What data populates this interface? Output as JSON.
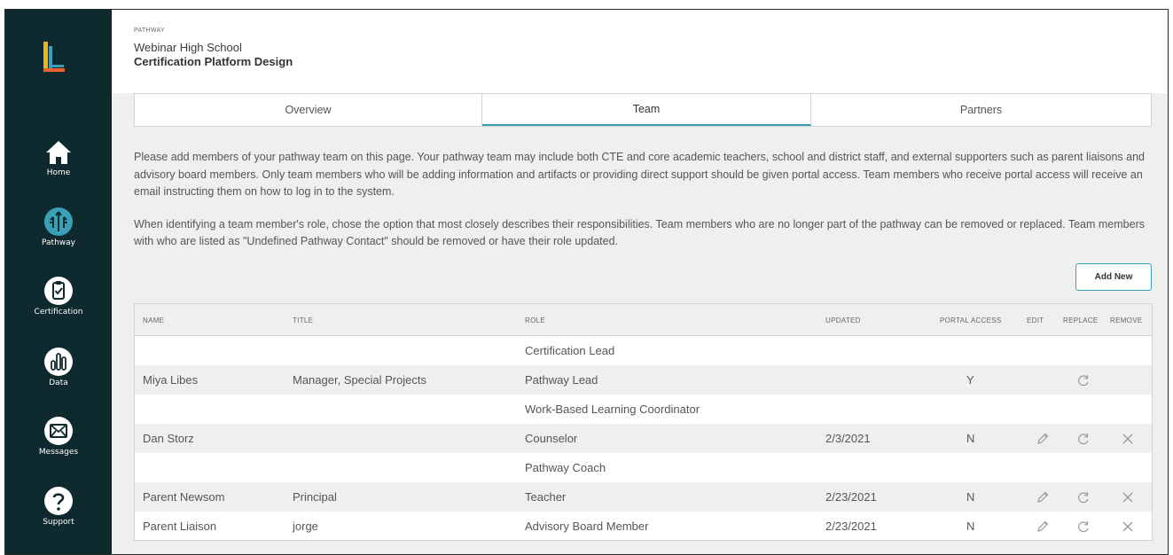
{
  "sidebar": {
    "items": [
      {
        "label": "Home",
        "icon": "home-icon"
      },
      {
        "label": "Pathway",
        "icon": "pathway-icon"
      },
      {
        "label": "Certification",
        "icon": "clipboard-check-icon"
      },
      {
        "label": "Data",
        "icon": "bar-chart-icon"
      },
      {
        "label": "Messages",
        "icon": "envelope-icon"
      },
      {
        "label": "Support",
        "icon": "question-icon"
      }
    ]
  },
  "header": {
    "breadcrumb": "PATHWAY",
    "school": "Webinar High School",
    "program": "Certification Platform Design"
  },
  "tabs": [
    {
      "label": "Overview",
      "active": false
    },
    {
      "label": "Team",
      "active": true
    },
    {
      "label": "Partners",
      "active": false
    }
  ],
  "intro": {
    "p1": "Please add members of your pathway team on this page. Your pathway team may include both CTE and core academic teachers, school and district staff, and external supporters such as parent liaisons and advisory board members. Only team members who will be adding information and artifacts or providing direct support should be given portal access. Team members who receive portal access will receive an email instructing them on how to log in to the system.",
    "p2": "When identifying a team member's role, chose the option that most closely describes their responsibilities. Team members who are no longer part of the pathway can be removed or replaced. Team members with who are listed as \"Undefined Pathway Contact\" should be removed or have their role updated."
  },
  "add_button": "Add New",
  "table": {
    "headers": {
      "name": "NAME",
      "title": "TITLE",
      "role": "ROLE",
      "updated": "UPDATED",
      "portal": "PORTAL ACCESS",
      "edit": "EDIT",
      "replace": "REPLACE",
      "remove": "REMOVE"
    },
    "rows": [
      {
        "name": "",
        "title": "",
        "role": "Certification Lead",
        "updated": "",
        "portal": "",
        "edit": false,
        "replace": false,
        "remove": false
      },
      {
        "name": "Miya Libes",
        "title": "Manager, Special Projects",
        "role": "Pathway Lead",
        "updated": "",
        "portal": "Y",
        "edit": false,
        "replace": true,
        "remove": false
      },
      {
        "name": "",
        "title": "",
        "role": "Work-Based Learning Coordinator",
        "updated": "",
        "portal": "",
        "edit": false,
        "replace": false,
        "remove": false
      },
      {
        "name": "Dan Storz",
        "title": "",
        "role": "Counselor",
        "updated": "2/3/2021",
        "portal": "N",
        "edit": true,
        "replace": true,
        "remove": true
      },
      {
        "name": "",
        "title": "",
        "role": "Pathway Coach",
        "updated": "",
        "portal": "",
        "edit": false,
        "replace": false,
        "remove": false
      },
      {
        "name": "Parent Newsom",
        "title": "Principal",
        "role": "Teacher",
        "updated": "2/23/2021",
        "portal": "N",
        "edit": true,
        "replace": true,
        "remove": true
      },
      {
        "name": "Parent Liaison",
        "title": "jorge",
        "role": "Advisory Board Member",
        "updated": "2/23/2021",
        "portal": "N",
        "edit": true,
        "replace": true,
        "remove": true
      }
    ]
  },
  "colors": {
    "sidebar": "#0f2a2e",
    "accent": "#3aa0b7",
    "logo_orange": "#e8622a",
    "logo_yellow": "#f2b21b",
    "logo_teal": "#3aa0b7"
  }
}
